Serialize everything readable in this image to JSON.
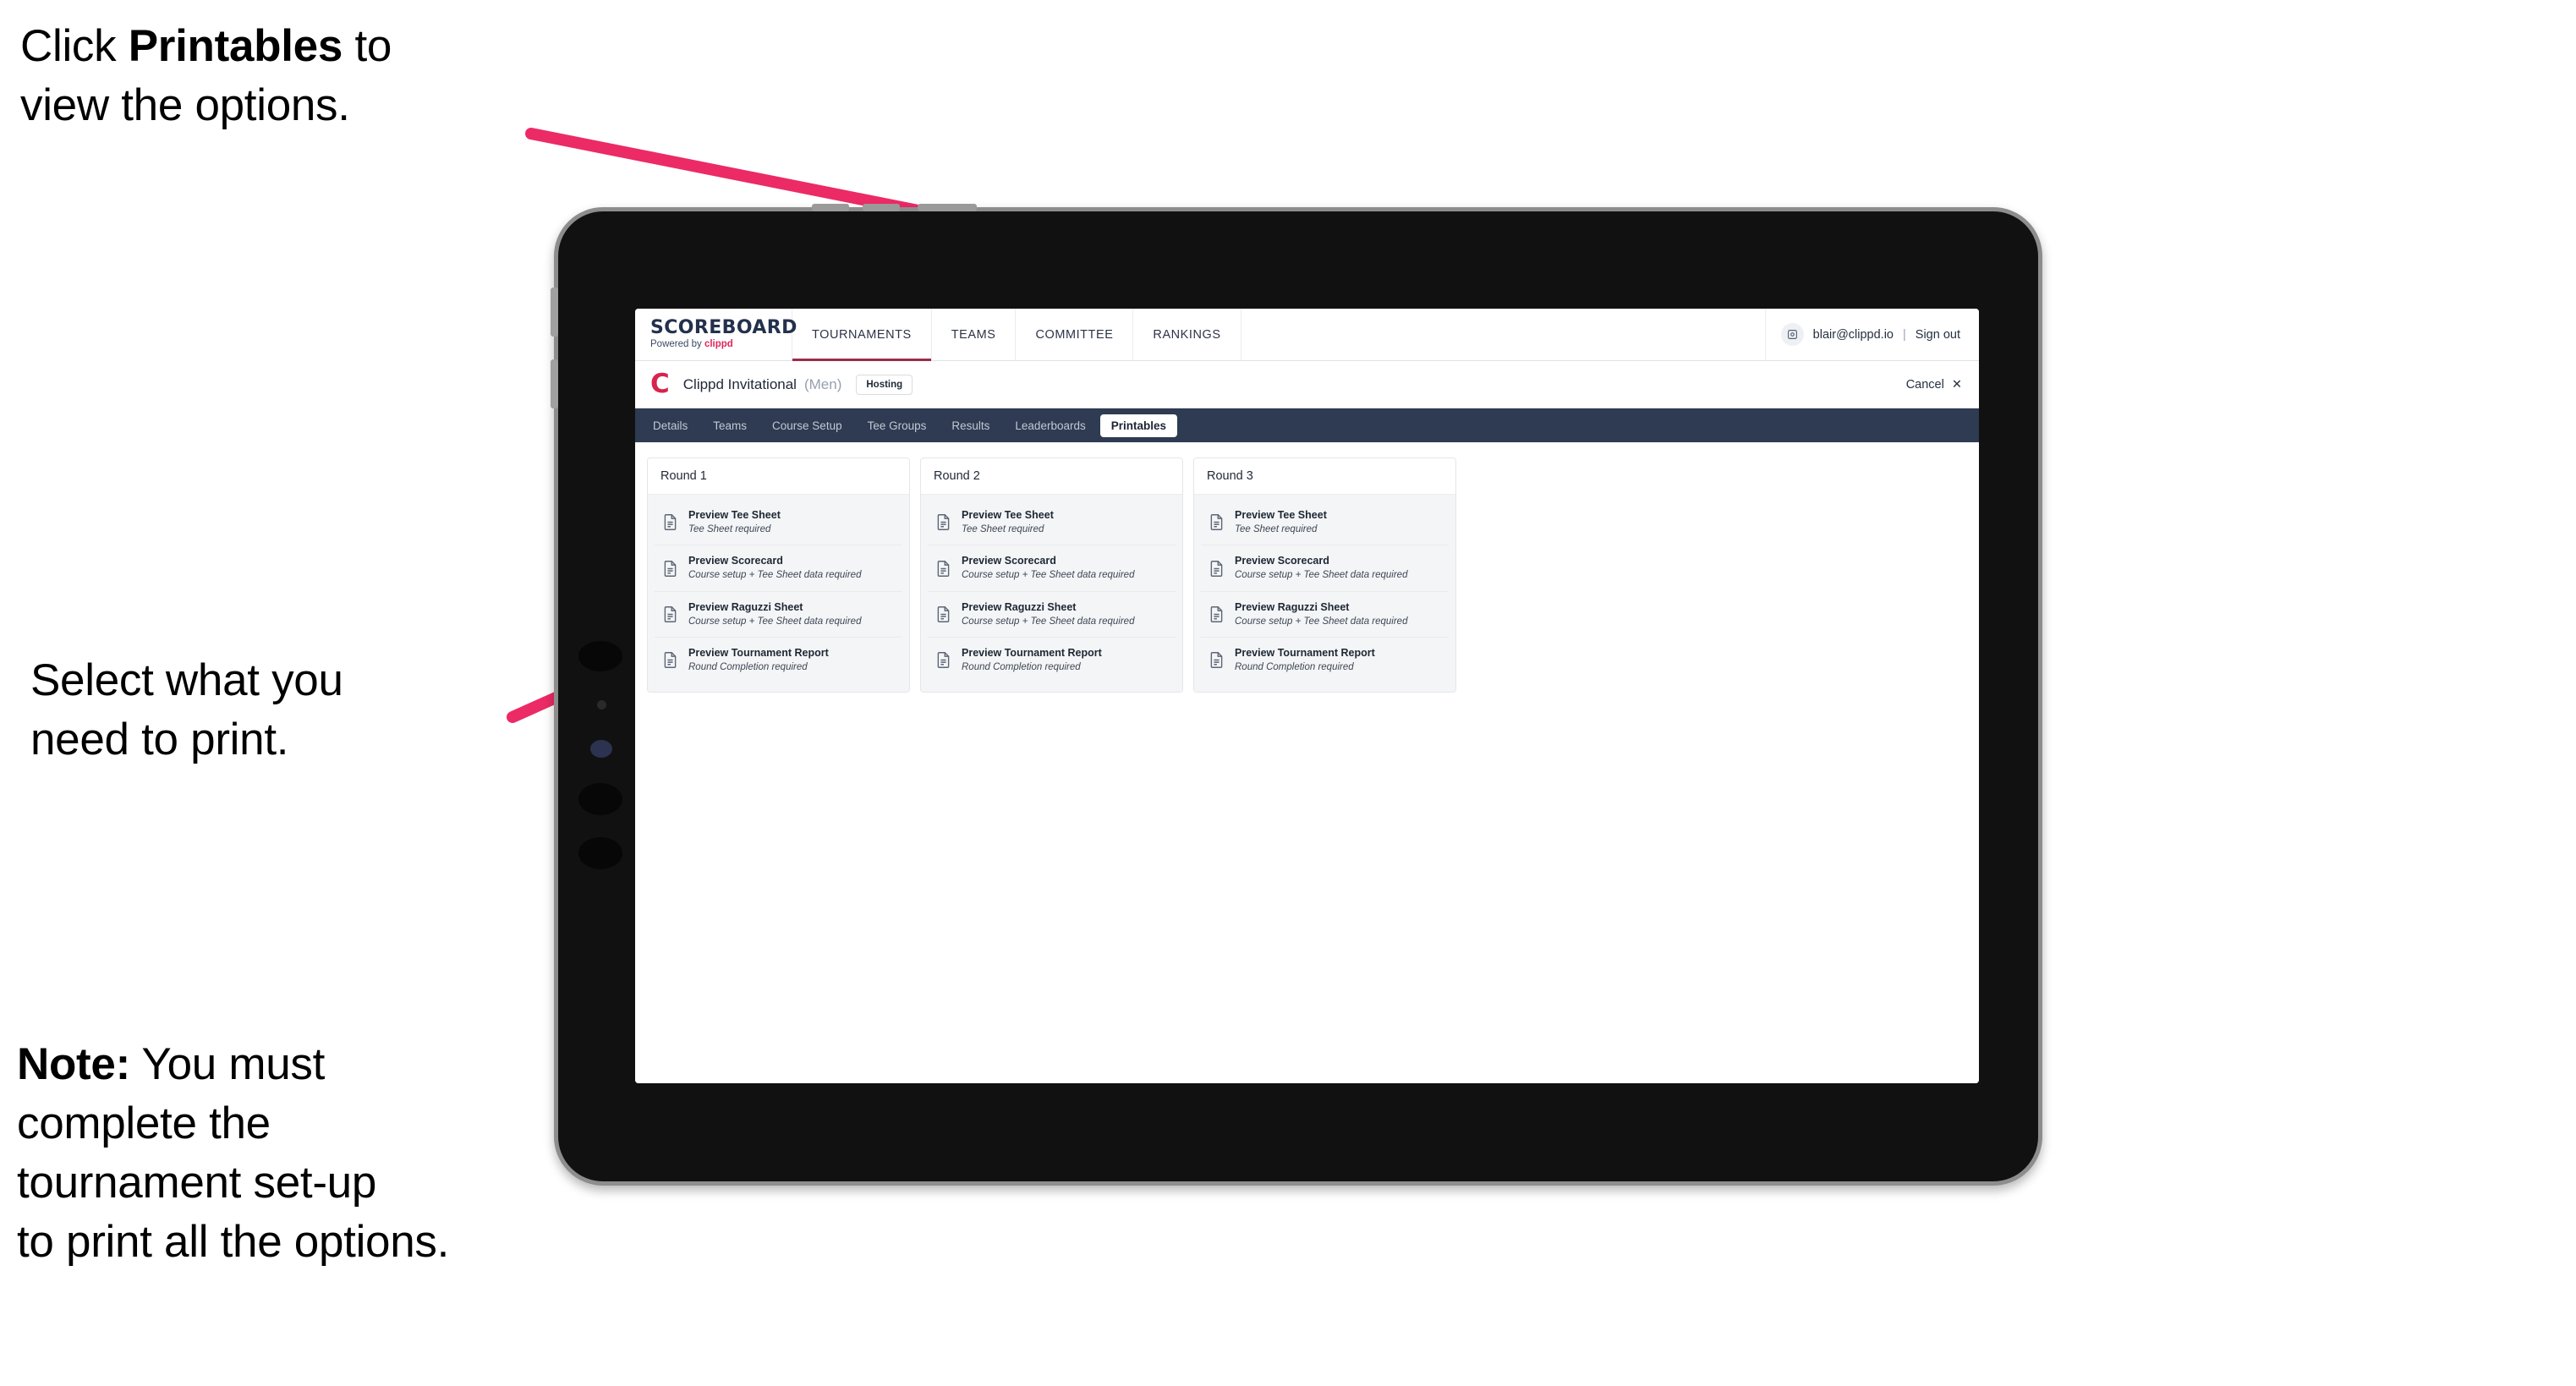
{
  "annotations": [
    {
      "id": "click-printables",
      "text_before": "Click ",
      "bold": "Printables",
      "text_after": " to\nview the options."
    },
    {
      "id": "select-print",
      "text": "Select what you\n need to print."
    },
    {
      "id": "note",
      "bold": "Note:",
      "text_after": " You must\ncomplete the\ntournament set-up\nto print all the options."
    }
  ],
  "browser": {
    "logo": {
      "word": "SCOREBOARD",
      "powered_prefix": "Powered by ",
      "brand": "clippd"
    },
    "nav": [
      {
        "label": "TOURNAMENTS",
        "active": true
      },
      {
        "label": "TEAMS",
        "active": false
      },
      {
        "label": "COMMITTEE",
        "active": false
      },
      {
        "label": "RANKINGS",
        "active": false
      }
    ],
    "user": {
      "avatar_icon": "user-avatar-icon",
      "email": "blair@clippd.io",
      "separator": "|",
      "sign_out": "Sign out"
    }
  },
  "tournament_header": {
    "logo_letter": "C",
    "name": "Clippd Invitational",
    "gender": "(Men)",
    "badge": "Hosting",
    "cancel_label": "Cancel",
    "cancel_icon": "✕"
  },
  "tabs": [
    {
      "label": "Details",
      "active": false
    },
    {
      "label": "Teams",
      "active": false
    },
    {
      "label": "Course Setup",
      "active": false
    },
    {
      "label": "Tee Groups",
      "active": false
    },
    {
      "label": "Results",
      "active": false
    },
    {
      "label": "Leaderboards",
      "active": false
    },
    {
      "label": "Printables",
      "active": true
    }
  ],
  "rounds": [
    {
      "title": "Round 1",
      "items": [
        {
          "title": "Preview Tee Sheet",
          "subtitle": "Tee Sheet required",
          "icon": "document-icon"
        },
        {
          "title": "Preview Scorecard",
          "subtitle": "Course setup + Tee Sheet data required",
          "icon": "document-icon"
        },
        {
          "title": "Preview Raguzzi Sheet",
          "subtitle": "Course setup + Tee Sheet data required",
          "icon": "document-icon"
        },
        {
          "title": "Preview Tournament Report",
          "subtitle": "Round Completion required",
          "icon": "document-icon"
        }
      ]
    },
    {
      "title": "Round 2",
      "items": [
        {
          "title": "Preview Tee Sheet",
          "subtitle": "Tee Sheet required",
          "icon": "document-icon"
        },
        {
          "title": "Preview Scorecard",
          "subtitle": "Course setup + Tee Sheet data required",
          "icon": "document-icon"
        },
        {
          "title": "Preview Raguzzi Sheet",
          "subtitle": "Course setup + Tee Sheet data required",
          "icon": "document-icon"
        },
        {
          "title": "Preview Tournament Report",
          "subtitle": "Round Completion required",
          "icon": "document-icon"
        }
      ]
    },
    {
      "title": "Round 3",
      "items": [
        {
          "title": "Preview Tee Sheet",
          "subtitle": "Tee Sheet required",
          "icon": "document-icon"
        },
        {
          "title": "Preview Scorecard",
          "subtitle": "Course setup + Tee Sheet data required",
          "icon": "document-icon"
        },
        {
          "title": "Preview Raguzzi Sheet",
          "subtitle": "Course setup + Tee Sheet data required",
          "icon": "document-icon"
        },
        {
          "title": "Preview Tournament Report",
          "subtitle": "Round Completion required",
          "icon": "document-icon"
        }
      ]
    }
  ],
  "colors": {
    "accent_pink": "#ec2a66",
    "brand_red": "#d8234e",
    "nav_dark": "#2e3b52",
    "logo_navy": "#23314d",
    "tab_active_underline": "#9e2a4a",
    "panel_bg": "#f4f5f7",
    "device_body": "#111111",
    "device_edge": "#8d8d8d"
  }
}
